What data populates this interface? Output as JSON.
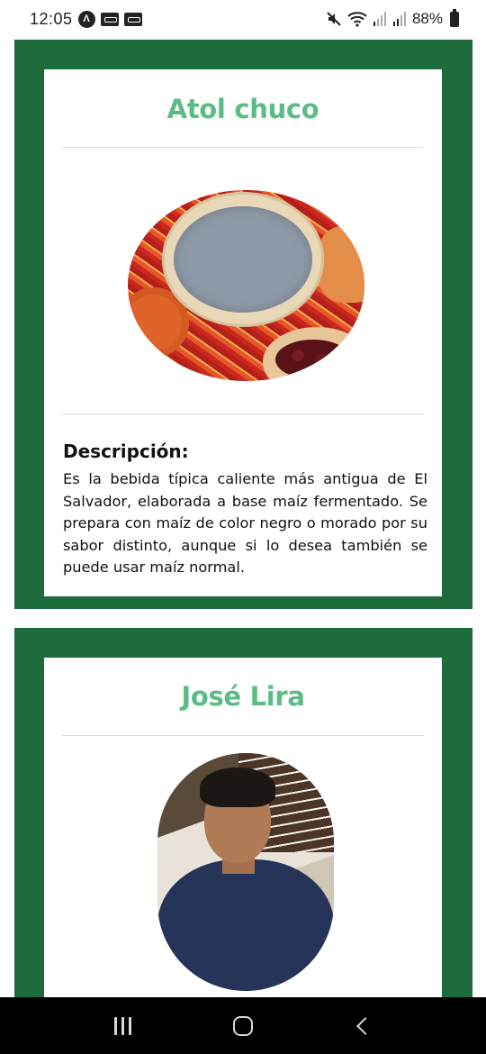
{
  "status_bar": {
    "time": "12:05",
    "notification_icons": [
      "app-a-icon",
      "voicemail-1-icon",
      "voicemail-2-icon"
    ],
    "right_icons": [
      "mute-icon",
      "wifi-icon",
      "signal-1-icon",
      "signal-2-icon"
    ],
    "battery_percent": "88%"
  },
  "cards": [
    {
      "title": "Atol chuco",
      "image_alt": "Atol chuco",
      "description_heading": "Descripción:",
      "description": "Es la bebida típica caliente más antigua de El Salvador, elaborada a base maíz fermentado. Se prepara con maíz de color negro o morado por su sabor distinto, aunque si lo desea también se puede usar maíz normal."
    },
    {
      "title": "José Lira",
      "image_alt": "José Lira"
    }
  ],
  "nav_bar": {
    "buttons": [
      "recent-apps",
      "home",
      "back"
    ]
  },
  "colors": {
    "frame": "#1e6b3b",
    "title": "#5bbc86",
    "text": "#111111"
  }
}
